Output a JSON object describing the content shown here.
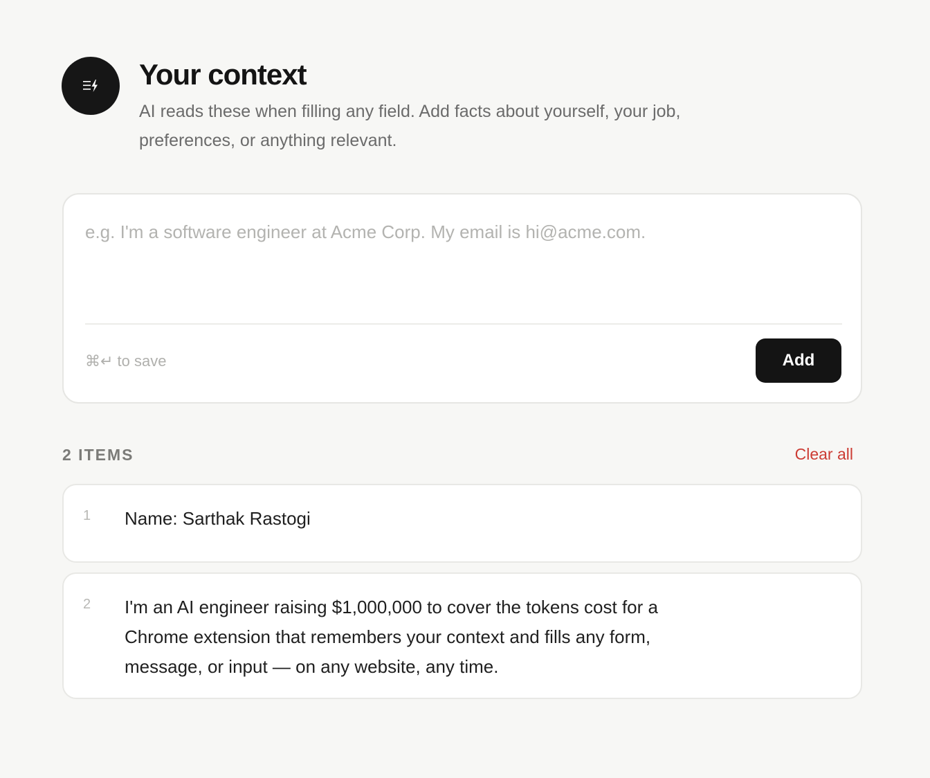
{
  "header": {
    "icon": "lines-bolt-icon",
    "title": "Your context",
    "subtitle": "AI reads these when filling any field. Add facts about yourself, your job, preferences, or anything relevant."
  },
  "composer": {
    "placeholder": "e.g. I'm a software engineer at Acme Corp. My email is hi@acme.com.",
    "value": "",
    "hint": "⌘↵ to save",
    "add_label": "Add"
  },
  "items_section": {
    "count_label": "2 ITEMS",
    "clear_label": "Clear all",
    "items": [
      {
        "number": "1",
        "text": "Name: Sarthak Rastogi"
      },
      {
        "number": "2",
        "text": "I'm an AI engineer raising $1,000,000 to cover the tokens cost for a Chrome extension that remembers your context and fills any form, message, or input — on any website, any time."
      }
    ]
  },
  "colors": {
    "background": "#f7f7f5",
    "primary": "#141414",
    "danger": "#cc3c34"
  }
}
